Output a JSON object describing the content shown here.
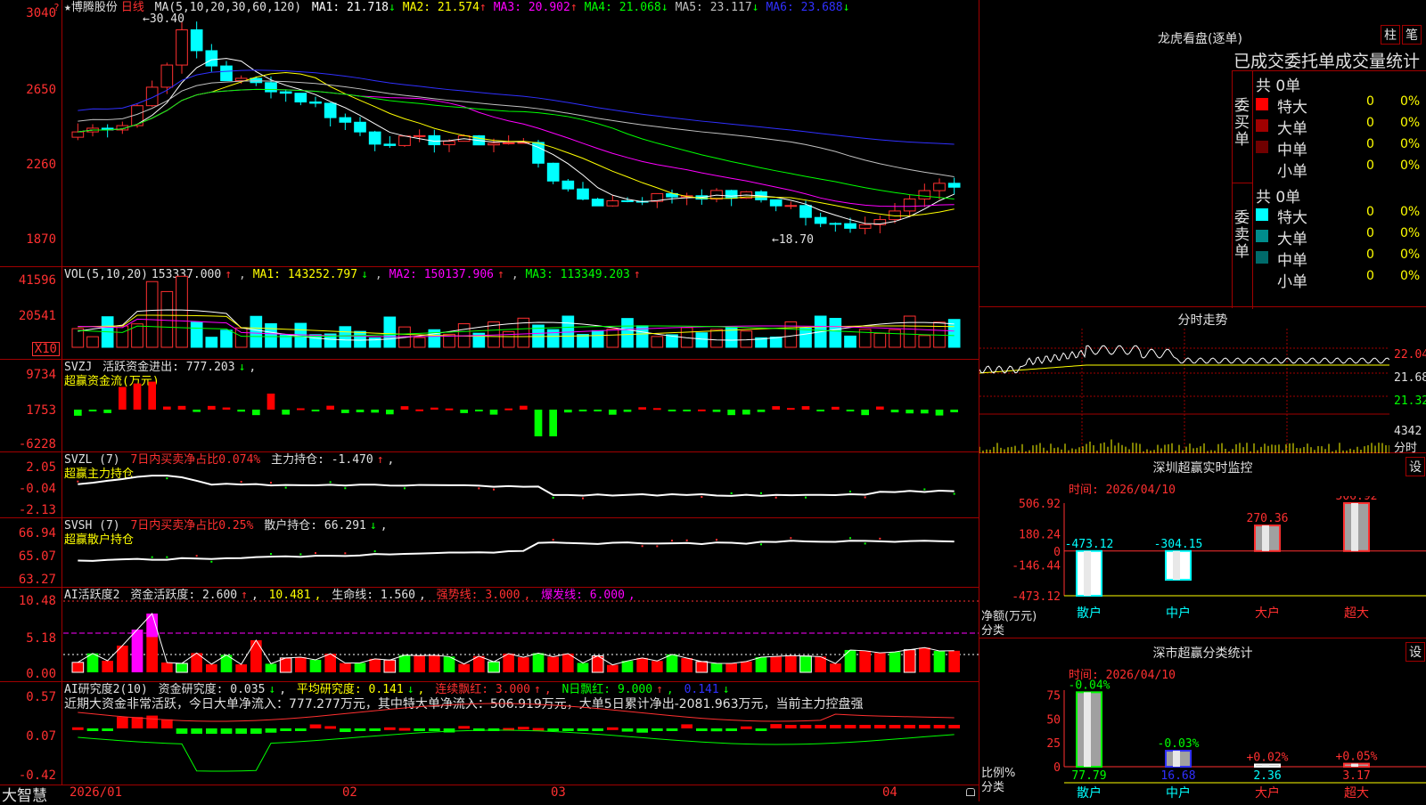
{
  "kline": {
    "title": "★博腾股份",
    "period": "日线",
    "ma_label": "MA(5,10,20,30,60,120)",
    "mas": [
      {
        "label": "MA1: 21.718",
        "arrow": "↓",
        "color": "#ffffff"
      },
      {
        "label": "MA2: 21.574",
        "arrow": "↑",
        "color": "#ffff00"
      },
      {
        "label": "MA3: 20.902",
        "arrow": "↑",
        "color": "#ff00ff"
      },
      {
        "label": "MA4: 21.068",
        "arrow": "↓",
        "color": "#00ff00"
      },
      {
        "label": "MA5: 23.117",
        "arrow": "↓",
        "color": "#c0c0c0"
      },
      {
        "label": "MA6: 23.688",
        "arrow": "↓",
        "color": "#3030ff"
      }
    ],
    "y_ticks": [
      "3040",
      "2650",
      "2260",
      "1870"
    ],
    "high_label": "30.40",
    "low_label": "18.70",
    "settings_icon": "?"
  },
  "vol": {
    "label": "VOL(5,10,20)",
    "value": "153337.000",
    "value_arrow": "↑",
    "ma1": "MA1: 143252.797",
    "ma1_arrow": "↓",
    "ma2": "MA2: 150137.906",
    "ma2_arrow": "↑",
    "ma3": "MA3: 113349.203",
    "ma3_arrow": "↑",
    "y_ticks": [
      "41596",
      "20541"
    ],
    "unit": "X10"
  },
  "svzj": {
    "label": "SVZJ",
    "text": "活跃资金进出: 777.203",
    "arrow": "↓",
    "subtitle": "超赢资金流(万元)",
    "y_ticks": [
      "9734",
      "1753",
      "-6228"
    ]
  },
  "svzl": {
    "label": "SVZL (7)",
    "ratio": "7日内买卖净占比0.074%",
    "pos": "主力持仓: -1.470",
    "arrow": "↑",
    "subtitle": "超赢主力持仓",
    "y_ticks": [
      "2.05",
      "-0.04",
      "-2.13"
    ]
  },
  "svsh": {
    "label": "SVSH (7)",
    "ratio": "7日内买卖净占比0.25%",
    "pos": "散户持仓: 66.291",
    "arrow": "↓",
    "subtitle": "超赢散户持仓",
    "y_ticks": [
      "66.94",
      "65.07",
      "63.27"
    ]
  },
  "ai1": {
    "label": "AI活跃度2",
    "t1": "资金活跃度: 2.600",
    "t1_arrow": "↑",
    "t2": "10.481",
    "t3": "生命线: 1.560",
    "t4": "强势线: 3.000",
    "t5": "爆发线: 6.000",
    "y_ticks": [
      "10.48",
      "5.18",
      "0.00"
    ]
  },
  "ai2": {
    "label": "AI研究度2(10)",
    "t1": "资金研究度: 0.035",
    "t1_arrow": "↓",
    "t2": "平均研究度: 0.141",
    "t2_arrow": "↓",
    "t3": "连续飘红: 3.000",
    "t3_arrow": "↑",
    "t4": "N日飘红: 9.000",
    "t4_arrow": "↑",
    "t5": "0.141",
    "t5_arrow": "↓",
    "summary": "近期大资金非常活跃，今日大单净流入：777.277万元，其中特大单净流入：506.919万元，大单5日累计净出-2081.963万元，当前主力控盘强",
    "y_ticks": [
      "0.57",
      "0.07",
      "-0.42"
    ]
  },
  "footer": {
    "brand": "大智慧",
    "dates": [
      "2026/01",
      "02",
      "03",
      "04"
    ]
  },
  "lhb": {
    "title": "龙虎看盘(逐单)",
    "btn1": "柱",
    "btn2": "笔",
    "tabs": "已成交委托单成交量统计",
    "buy_side": "委买单",
    "sell_side": "委卖单",
    "buy_total": "共 0单",
    "sell_total": "共 0单",
    "buy_rows": [
      {
        "label": "特大",
        "count": "0",
        "pct": "0%",
        "color": "#ff0000"
      },
      {
        "label": "大单",
        "count": "0",
        "pct": "0%",
        "color": "#a00000"
      },
      {
        "label": "中单",
        "count": "0",
        "pct": "0%",
        "color": "#700000"
      },
      {
        "label": "小单",
        "count": "0",
        "pct": "0%",
        "color": "#000000"
      }
    ],
    "sell_rows": [
      {
        "label": "特大",
        "count": "0",
        "pct": "0%",
        "color": "#00ffff"
      },
      {
        "label": "大单",
        "count": "0",
        "pct": "0%",
        "color": "#008c8c"
      },
      {
        "label": "中单",
        "count": "0",
        "pct": "0%",
        "color": "#006a6a"
      },
      {
        "label": "小单",
        "count": "0",
        "pct": "0%",
        "color": "#000000"
      }
    ]
  },
  "intraday": {
    "title": "分时走势",
    "prices": [
      "22.04",
      "21.68",
      "21.32"
    ],
    "vol": "4342",
    "vol_label": "分时"
  },
  "sz_monitor": {
    "title": "深圳超赢实时监控",
    "settings": "设",
    "time": "时间: 2026/04/10",
    "y_ticks": [
      "506.92",
      "180.24",
      "0",
      "-146.44",
      "-473.12"
    ],
    "unit": "净额(万元)",
    "cat_label": "分类",
    "chart_data": {
      "type": "bar",
      "categories": [
        "散户",
        "中户",
        "大户",
        "超大"
      ],
      "values": [
        -473.12,
        -304.15,
        270.36,
        506.92
      ],
      "ylim": [
        -473.12,
        506.92
      ]
    }
  },
  "sz_stats": {
    "title": "深市超赢分类统计",
    "settings": "设",
    "time": "时间: 2026/04/10",
    "y_ticks": [
      "75",
      "50",
      "25",
      "0"
    ],
    "unit": "比例%",
    "cat_label": "分类",
    "chart_data": {
      "type": "bar",
      "categories": [
        "散户",
        "中户",
        "大户",
        "超大"
      ],
      "values": [
        77.79,
        16.68,
        2.36,
        3.17
      ],
      "changes": [
        "-0.04%",
        "-0.03%",
        "+0.02%",
        "+0.05%"
      ],
      "ylim": [
        0,
        80
      ]
    }
  }
}
